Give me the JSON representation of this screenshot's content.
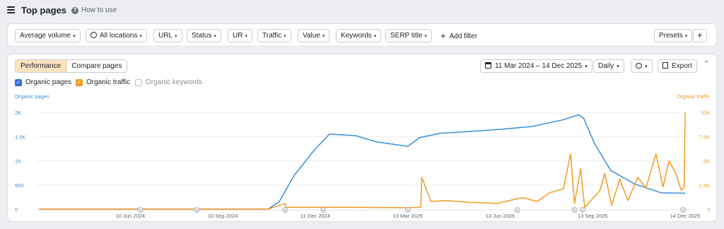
{
  "header": {
    "title": "Top pages",
    "help_label": "How to use"
  },
  "filters": {
    "average_volume": "Average volume",
    "locations": "All locations",
    "url": "URL",
    "status": "Status",
    "ur": "UR",
    "traffic": "Traffic",
    "value": "Value",
    "keywords": "Keywords",
    "serp_title": "SERP title",
    "add_filter": "Add filter",
    "presets": "Presets"
  },
  "panel": {
    "tab_performance": "Performance",
    "tab_compare": "Compare pages",
    "date_range": "11 Mar 2024 – 14 Dec 2025",
    "granularity": "Daily",
    "export": "Export"
  },
  "legend": {
    "organic_pages": "Organic pages",
    "organic_traffic": "Organic traffic",
    "organic_keywords": "Organic keywords"
  },
  "colors": {
    "pages": "#3a8fd6",
    "traffic": "#f39a1e",
    "accent_bg": "#fde2c0"
  },
  "chart_data": {
    "type": "line",
    "left_axis_title": "Organic pages",
    "right_axis_title": "Organic traffic",
    "left_ticks": [
      "0",
      "500",
      "1K",
      "1.5K",
      "2K"
    ],
    "right_ticks": [
      "0",
      "2.5K",
      "5K",
      "7.5K",
      "10K"
    ],
    "ylim_left": [
      0,
      2000
    ],
    "ylim_right": [
      0,
      10000
    ],
    "x_tick_labels": [
      "10 Jun 2024",
      "10 Sep 2024",
      "11 Dec 2024",
      "13 Mar 2025",
      "13 Jun 2025",
      "13 Sep 2025",
      "14 Dec 2025"
    ],
    "x_ticks": [
      "2024-06-10",
      "2024-09-10",
      "2024-12-11",
      "2025-03-13",
      "2025-06-13",
      "2025-09-13",
      "2025-12-14"
    ],
    "xlim": [
      "2024-03-11",
      "2025-12-14"
    ],
    "annotation_label": "G",
    "annotations": [
      "2024-06-20",
      "2024-08-15",
      "2024-11-11",
      "2024-12-19",
      "2025-03-13",
      "2025-06-30",
      "2025-08-26",
      "2025-09-03",
      "2025-12-12"
    ],
    "series": [
      {
        "name": "Organic pages",
        "axis": "left",
        "x": [
          "2024-03-11",
          "2024-06-10",
          "2024-09-10",
          "2024-10-25",
          "2024-11-05",
          "2024-11-20",
          "2024-12-10",
          "2024-12-25",
          "2025-01-20",
          "2025-02-10",
          "2025-03-13",
          "2025-03-25",
          "2025-04-15",
          "2025-05-10",
          "2025-06-13",
          "2025-07-15",
          "2025-08-15",
          "2025-08-30",
          "2025-09-04",
          "2025-09-15",
          "2025-10-01",
          "2025-10-25",
          "2025-11-20",
          "2025-12-14"
        ],
        "values": [
          5,
          5,
          5,
          5,
          150,
          700,
          1220,
          1550,
          1520,
          1390,
          1300,
          1480,
          1570,
          1600,
          1650,
          1710,
          1850,
          1950,
          1880,
          1350,
          800,
          520,
          340,
          330
        ]
      },
      {
        "name": "Organic traffic",
        "axis": "right",
        "x": [
          "2024-03-11",
          "2024-10-25",
          "2024-11-11",
          "2024-11-12",
          "2024-11-13",
          "2025-01-15",
          "2025-03-13",
          "2025-03-26",
          "2025-03-27",
          "2025-04-05",
          "2025-04-20",
          "2025-05-15",
          "2025-06-10",
          "2025-07-05",
          "2025-07-20",
          "2025-08-01",
          "2025-08-15",
          "2025-08-22",
          "2025-08-26",
          "2025-09-01",
          "2025-09-05",
          "2025-09-20",
          "2025-09-25",
          "2025-10-02",
          "2025-10-10",
          "2025-10-18",
          "2025-10-28",
          "2025-11-05",
          "2025-11-15",
          "2025-11-22",
          "2025-11-28",
          "2025-12-05",
          "2025-12-10",
          "2025-12-13",
          "2025-12-14"
        ],
        "values": [
          10,
          10,
          600,
          50,
          200,
          200,
          150,
          200,
          3300,
          800,
          900,
          700,
          600,
          1200,
          800,
          1700,
          2100,
          5700,
          600,
          4200,
          200,
          1900,
          3700,
          400,
          3100,
          900,
          3300,
          2200,
          5700,
          2300,
          5000,
          3600,
          2000,
          2200,
          10000
        ]
      }
    ]
  }
}
